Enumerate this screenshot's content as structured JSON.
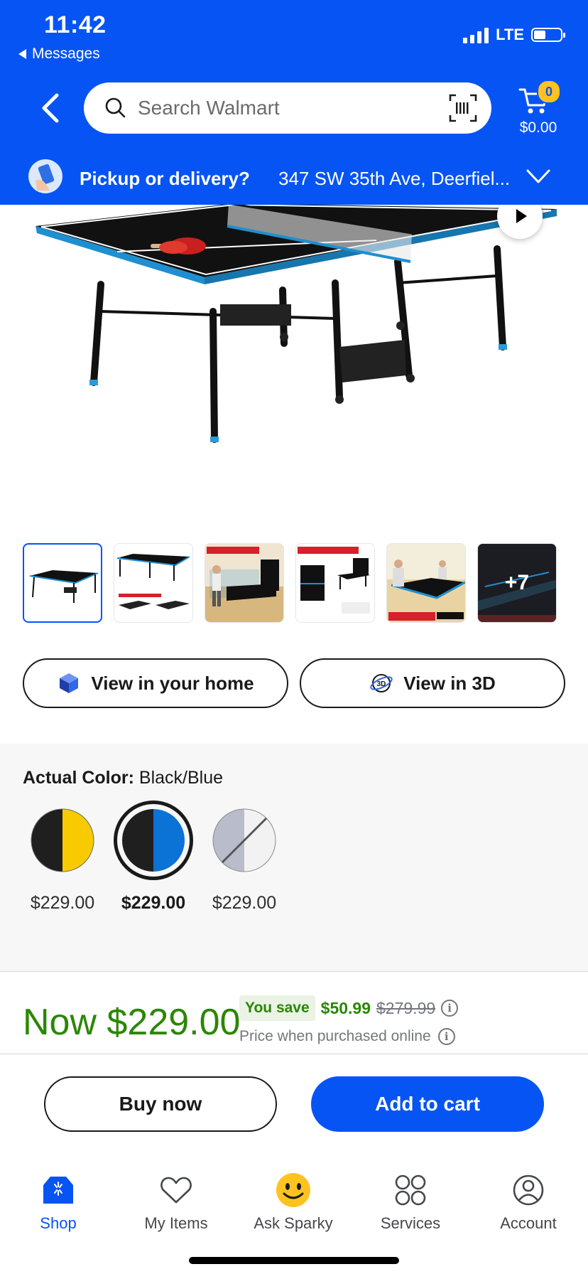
{
  "status": {
    "time": "11:42",
    "back_app": "Messages",
    "network": "LTE"
  },
  "header": {
    "search_placeholder": "Search Walmart",
    "cart_count": "0",
    "cart_total": "$0.00"
  },
  "pickup": {
    "question": "Pickup or delivery?",
    "address": "347 SW 35th Ave, Deerfiel..."
  },
  "gallery": {
    "more_count": "+7",
    "thumb_captions": [
      "",
      "",
      "PLAYBACK POSITION",
      "SPACE SAVING STORAGE",
      "OFFICIAL TOURNAMENT SIZE",
      ""
    ]
  },
  "view_buttons": {
    "home": "View in your home",
    "three_d": "View in 3D"
  },
  "color": {
    "label": "Actual Color:",
    "value": "Black/Blue",
    "swatches": [
      {
        "price": "$229.00",
        "left": "#1f1f1f",
        "right": "#f8cb00",
        "selected": false
      },
      {
        "price": "$229.00",
        "left": "#1f1f1f",
        "right": "#0b72d6",
        "selected": true
      },
      {
        "price": "$229.00",
        "left": "#b9bccb",
        "right": "#f2f2f2",
        "selected": false
      }
    ]
  },
  "price": {
    "now": "Now $229.00",
    "you_save_label": "You save",
    "save_amount": "$50.99",
    "was": "$279.99",
    "online_note": "Price when purchased online"
  },
  "actions": {
    "buy_now": "Buy now",
    "add_to_cart": "Add to cart"
  },
  "tabs": [
    {
      "label": "Shop",
      "icon": "shop-icon",
      "active": true
    },
    {
      "label": "My Items",
      "icon": "heart-icon",
      "active": false
    },
    {
      "label": "Ask Sparky",
      "icon": "sparky-icon",
      "active": false
    },
    {
      "label": "Services",
      "icon": "services-icon",
      "active": false
    },
    {
      "label": "Account",
      "icon": "account-icon",
      "active": false
    }
  ],
  "colors": {
    "brand_blue": "#0654f3",
    "price_green": "#2a8703",
    "spark_yellow": "#ffc220"
  }
}
